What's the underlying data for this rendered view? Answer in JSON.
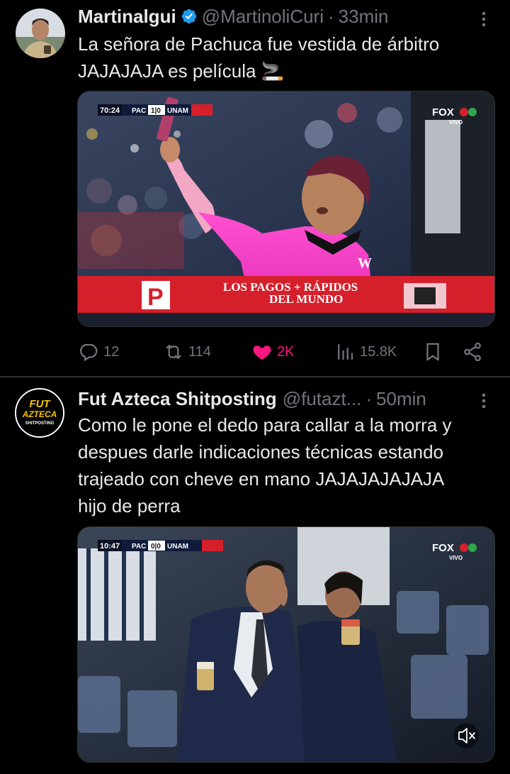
{
  "tweets": [
    {
      "author_name": "Martinalgui",
      "handle": "@MartinoliCuri",
      "separator": "·",
      "time": "33min",
      "text": "La señora de Pachuca fue vestida de árbitro\nJAJAJAJA es película 🚬",
      "media": {
        "scoreboard_time": "70:24",
        "home_team": "PAC",
        "score": "1|0",
        "away_team": "UNAM",
        "network": "FOX",
        "live_label": "VIVO",
        "ad_logo": "P",
        "ad_text_line1": "LOS PAGOS + RÁPIDOS",
        "ad_text_line2": "DEL MUNDO",
        "jersey_logo": "W"
      },
      "stats": {
        "replies": "12",
        "retweets": "114",
        "likes": "2K",
        "views": "15.8K"
      },
      "liked": true,
      "colors": {
        "like": "#f91880",
        "verified": "#1d9bf0",
        "muted": "#71767b"
      }
    },
    {
      "author_name": "Fut Azteca Shitposting",
      "handle": "@futazt...",
      "separator": "·",
      "time": "50min",
      "text": "Como le pone el dedo para callar a la morra y\ndespues darle indicaciones técnicas estando\ntrajeado con cheve en mano JAJAJAJAJAJA\nhijo de perra",
      "avatar_text_line1": "FUT",
      "avatar_text_line2": "AZTECA",
      "avatar_text_line3": "SHITPOSTING",
      "media": {
        "scoreboard_time": "10:47",
        "home_team": "PAC",
        "score": "0|0",
        "away_team": "UNAM",
        "network": "FOX",
        "live_label": "VIVO",
        "mute_icon": "speaker-muted-icon"
      }
    }
  ]
}
